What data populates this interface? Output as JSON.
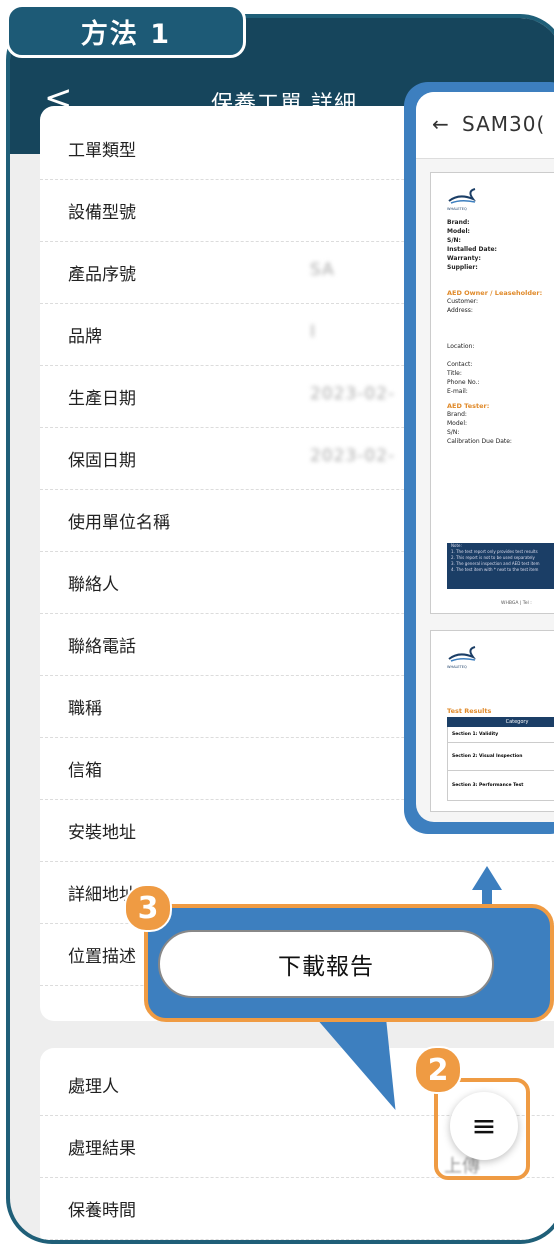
{
  "method_tab": "方法 1",
  "header": {
    "back": "<",
    "title": "保養工單 詳細"
  },
  "details": [
    {
      "label": "工單類型",
      "value": ""
    },
    {
      "label": "設備型號",
      "value": ""
    },
    {
      "label": "產品序號",
      "value": "SA"
    },
    {
      "label": "品牌",
      "value": "I"
    },
    {
      "label": "生產日期",
      "value": "2023-02-"
    },
    {
      "label": "保固日期",
      "value": "2023-02-"
    },
    {
      "label": "使用單位名稱",
      "value": ""
    },
    {
      "label": "聯絡人",
      "value": ""
    },
    {
      "label": "聯絡電話",
      "value": ""
    },
    {
      "label": "職稱",
      "value": ""
    },
    {
      "label": "信箱",
      "value": ""
    },
    {
      "label": "安裝地址",
      "value": ""
    },
    {
      "label": "詳細地址",
      "value": ""
    },
    {
      "label": "位置描述",
      "value": ""
    }
  ],
  "process": [
    {
      "label": "處理人",
      "value": ""
    },
    {
      "label": "處理結果",
      "value": ""
    },
    {
      "label": "保養時間",
      "value": ""
    }
  ],
  "report": {
    "back": "←",
    "title": "SAM30(",
    "brand_name": "WHALETEQ",
    "device_fields": [
      "Brand:",
      "Model:",
      "S/N:",
      "Installed Date:",
      "Warranty:",
      "Supplier:"
    ],
    "owner_heading": "AED Owner / Leaseholder:",
    "owner_fields": [
      "Customer:",
      "Address:",
      "Location:",
      "Contact:",
      "Title:",
      "Phone No.:",
      "E-mail:"
    ],
    "tester_heading": "AED Tester:",
    "tester_fields": [
      "Brand:",
      "Model:",
      "S/N:",
      "Calibration Due Date:"
    ],
    "note_lines": [
      "Note:",
      "1. The test report only provides test results",
      "2. This report is not to be used separately",
      "3. The general inspection and AED test item",
      "4. The test item with * next to the test item"
    ],
    "footer": "WHBGA | Tel :",
    "test_results_heading": "Test Results",
    "table_header": "Category",
    "table_rows": [
      "Section 1: Validity",
      "Section 2: Visual Inspection",
      "Section 3: Performance Test"
    ]
  },
  "download_button": "下載報告",
  "badges": {
    "step3": "3",
    "step2": "2"
  },
  "menu_icon": "≡",
  "colors": {
    "header": "#16455c",
    "accent_orange": "#ef9b43",
    "callout_blue": "#3d7fbf"
  }
}
